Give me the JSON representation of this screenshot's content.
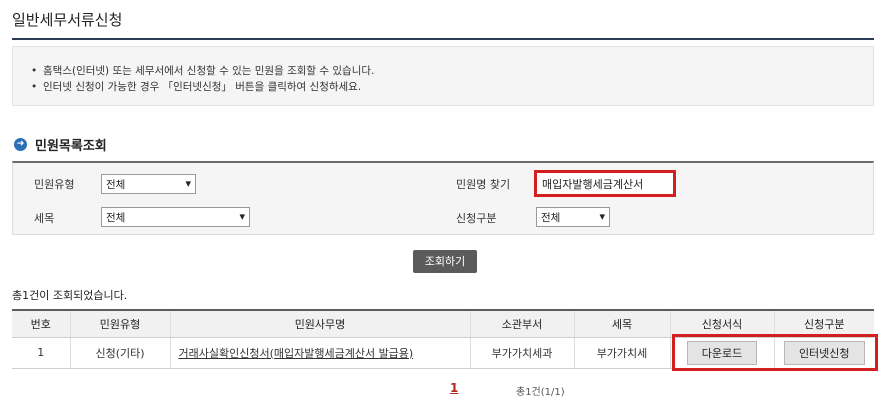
{
  "page": {
    "title": "일반세무서류신청"
  },
  "info": {
    "lines": [
      "홈택스(인터넷) 또는 세무서에서 신청할 수 있는 민원을 조회할 수 있습니다.",
      "인터넷 신청이 가능한 경우 「인터넷신청」 버튼을 클릭하여 신청하세요."
    ],
    "bullet": "•"
  },
  "section": {
    "title": "민원목록조회",
    "icon": "arrow-right-circle-icon"
  },
  "search": {
    "type_label": "민원유형",
    "type_value": "전체",
    "name_label": "민원명 찾기",
    "name_value": "매입자발행세금계산서",
    "tax_label": "세목",
    "tax_value": "전체",
    "apply_label": "신청구분",
    "apply_value": "전체",
    "caret": "▾",
    "button": "조회하기"
  },
  "result": {
    "count_text": "총1건이 조회되었습니다.",
    "headers": [
      "번호",
      "민원유형",
      "민원사무명",
      "소관부서",
      "세목",
      "신청서식",
      "신청구분"
    ],
    "rows": [
      {
        "no": "1",
        "type": "신청(기타)",
        "name": "거래사실확인신청서(매입자발행세금계산서 발급용)",
        "dept": "부가가치세과",
        "tax": "부가가치세",
        "form_button": "다운로드",
        "apply_button": "인터넷신청"
      }
    ]
  },
  "pagination": {
    "current": "1",
    "total": "총1건(1/1)"
  },
  "colors": {
    "highlight": "#d21f1f",
    "link": "#1a3aa8",
    "accent": "#2d6fb5"
  }
}
